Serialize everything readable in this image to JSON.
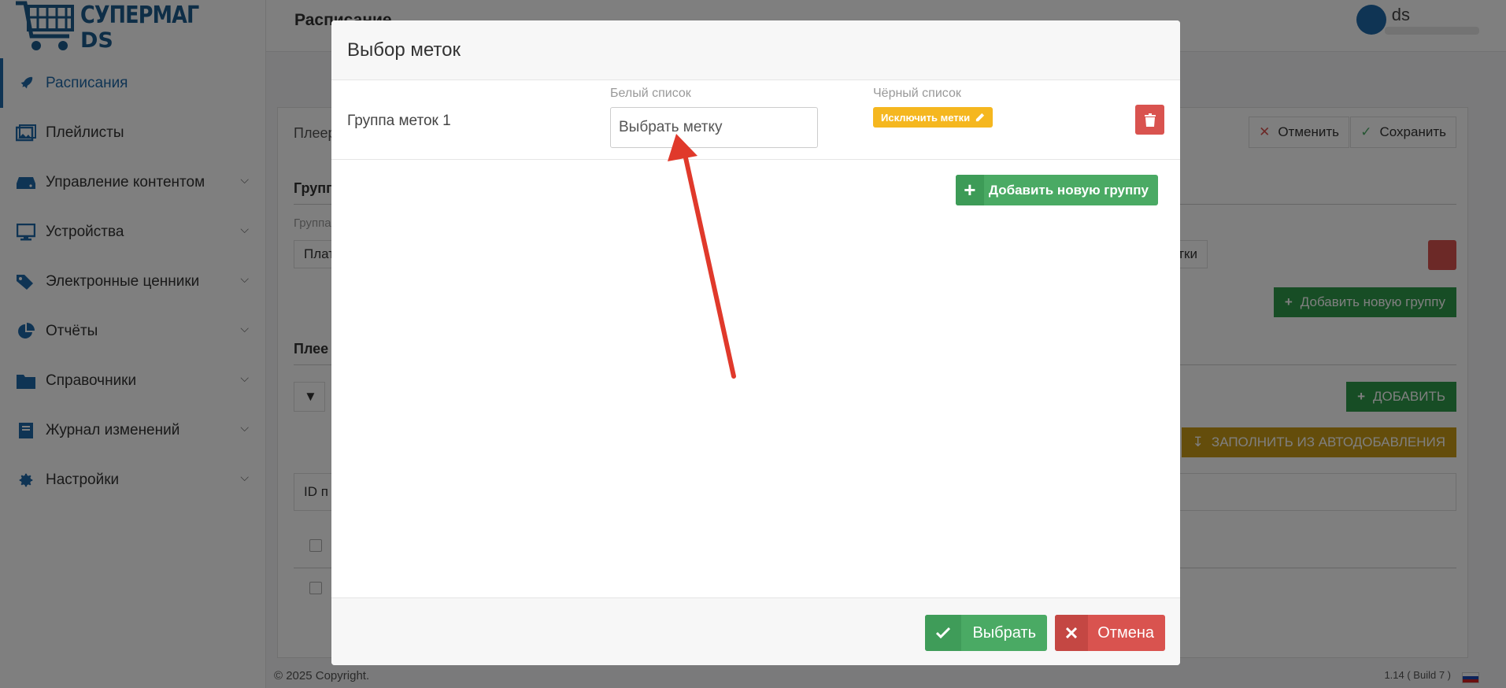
{
  "app": {
    "logo_title": "СУПЕРМАГ",
    "logo_sub": "DS",
    "page_title": "Расписание",
    "user_name": "ds"
  },
  "sidebar": {
    "items": [
      {
        "label": "Расписания",
        "icon": "rocket-icon",
        "active": true,
        "has_children": false
      },
      {
        "label": "Плейлисты",
        "icon": "images-icon",
        "active": false,
        "has_children": false
      },
      {
        "label": "Управление контентом",
        "icon": "hdd-icon",
        "active": false,
        "has_children": true
      },
      {
        "label": "Устройства",
        "icon": "monitor-icon",
        "active": false,
        "has_children": true
      },
      {
        "label": "Электронные ценники",
        "icon": "tags-icon",
        "active": false,
        "has_children": true
      },
      {
        "label": "Отчёты",
        "icon": "pie-chart-icon",
        "active": false,
        "has_children": true
      },
      {
        "label": "Справочники",
        "icon": "folder-icon",
        "active": false,
        "has_children": true
      },
      {
        "label": "Журнал изменений",
        "icon": "book-icon",
        "active": false,
        "has_children": true
      },
      {
        "label": "Настройки",
        "icon": "gear-icon",
        "active": false,
        "has_children": true
      }
    ]
  },
  "background": {
    "cancel_label": "Отменить",
    "save_label": "Сохранить",
    "add_group_label": "Добавить новую группу",
    "add_label": "ДОБАВИТЬ",
    "fill_label": "ЗАПОЛНИТЬ ИЗ АВТОДОБАВЛЕНИЯ",
    "players_fragment": "Плеер",
    "group_fragment": "Групп",
    "group_sub_fragment": "Группа",
    "plat_fragment": "Плат",
    "tags_fragment": "тки",
    "players_header_fragment": "Плее",
    "id_fragment": "ID п"
  },
  "modal": {
    "title": "Выбор меток",
    "group_name": "Группа меток 1",
    "whitelist_label": "Белый список",
    "whitelist_placeholder": "Выбрать метку",
    "blacklist_label": "Чёрный список",
    "exclude_button": "Исключить метки",
    "add_group_button": "Добавить новую группу",
    "select_button": "Выбрать",
    "cancel_button": "Отмена"
  },
  "footer": {
    "copyright": "© 2025 Copyright.",
    "version": "1.14 ( Build 7 )"
  },
  "colors": {
    "brand": "#1f68a8",
    "success": "#4aaa64",
    "danger": "#d9534f",
    "warning": "#f5b71f"
  }
}
